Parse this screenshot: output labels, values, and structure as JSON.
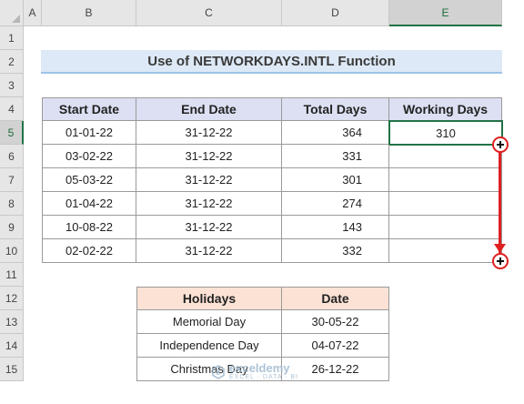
{
  "columns": [
    "A",
    "B",
    "C",
    "D",
    "E"
  ],
  "rows": [
    "1",
    "2",
    "3",
    "4",
    "5",
    "6",
    "7",
    "8",
    "9",
    "10",
    "11",
    "12",
    "13",
    "14",
    "15"
  ],
  "title": "Use of NETWORKDAYS.INTL Function",
  "main_table": {
    "headers": [
      "Start Date",
      "End Date",
      "Total Days",
      "Working Days"
    ],
    "rows": [
      [
        "01-01-22",
        "31-12-22",
        "364",
        "310"
      ],
      [
        "03-02-22",
        "31-12-22",
        "331",
        ""
      ],
      [
        "05-03-22",
        "31-12-22",
        "301",
        ""
      ],
      [
        "01-04-22",
        "31-12-22",
        "274",
        ""
      ],
      [
        "10-08-22",
        "31-12-22",
        "143",
        ""
      ],
      [
        "02-02-22",
        "31-12-22",
        "332",
        ""
      ]
    ]
  },
  "holidays_table": {
    "headers": [
      "Holidays",
      "Date"
    ],
    "rows": [
      [
        "Memorial Day",
        "30-05-22"
      ],
      [
        "Independence Day",
        "04-07-22"
      ],
      [
        "Christmas Day",
        "26-12-22"
      ]
    ]
  },
  "watermark": {
    "brand": "exceldemy",
    "tagline": "EXCEL · DATA · BI"
  },
  "colors": {
    "accent": "#217346",
    "header_blue": "#dde0f3",
    "header_peach": "#fbe2d5",
    "title_bg": "#dde9f6",
    "arrow": "#e02020"
  }
}
